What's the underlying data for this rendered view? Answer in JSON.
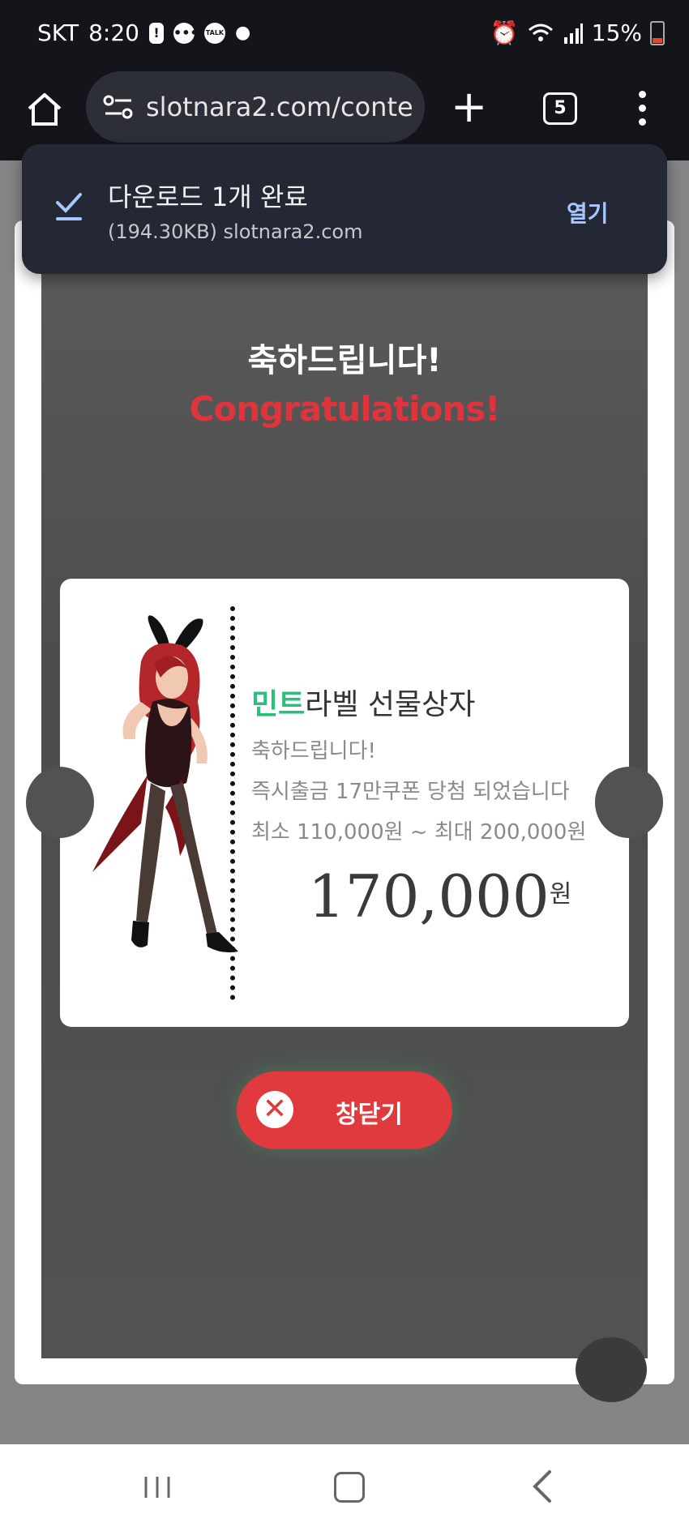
{
  "status_bar": {
    "carrier": "SKT",
    "time": "8:20",
    "battery": "15%",
    "icons": [
      "alert-icon",
      "chat-icon",
      "kakaotalk-icon",
      "dot-icon",
      "alarm-icon",
      "wifi-icon",
      "signal-icon",
      "battery-icon"
    ],
    "talk_label": "TALK"
  },
  "browser": {
    "url": "slotnara2.com/conte",
    "tab_count": "5",
    "icons": [
      "home-icon",
      "site-settings-icon",
      "new-tab-icon",
      "tabs-icon",
      "more-icon"
    ]
  },
  "download_toast": {
    "title": "다운로드 1개 완료",
    "subtitle": "(194.30KB) slotnara2.com",
    "action": "열기"
  },
  "modal": {
    "title_ko": "축하드립니다!",
    "title_en": "Congratulations!",
    "coupon": {
      "head_accent": "민트",
      "head_rest": "라벨 선물상자",
      "line1": "축하드립니다!",
      "line2": "즉시출금 17만쿠폰 당첨 되었습니다",
      "line3": "최소 110,000원 ~ 최대 200,000원",
      "amount": "170,000",
      "unit": "원"
    },
    "close_label": "창닫기"
  },
  "colors": {
    "accent_mint": "#2bbf7a",
    "congrats_red": "#e0343c",
    "close_button": "#e0393e",
    "toast_bg": "#242734",
    "toast_action": "#a9c7ff"
  }
}
